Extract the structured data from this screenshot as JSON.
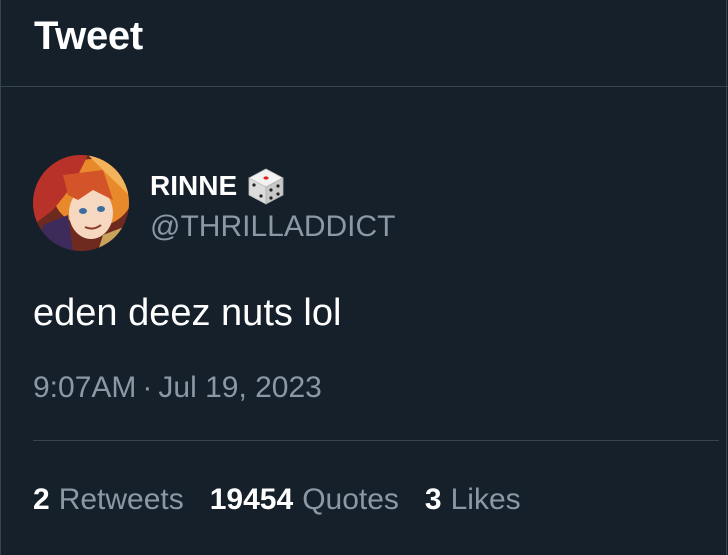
{
  "header": {
    "title": "Tweet"
  },
  "author": {
    "display_name": "RINNE",
    "badge_icon": "dice-icon",
    "handle": "@THRILLADDICT",
    "avatar_colors": [
      "#c0392b",
      "#e8892b",
      "#f3c270"
    ]
  },
  "tweet": {
    "text": "eden deez nuts lol",
    "time": "9:07AM",
    "separator": "·",
    "date": "Jul 19, 2023"
  },
  "stats": {
    "retweets_count": "2",
    "retweets_label": "Retweets",
    "quotes_count": "19454",
    "quotes_label": "Quotes",
    "likes_count": "3",
    "likes_label": "Likes"
  },
  "colors": {
    "background": "#15202b",
    "border": "#38444d",
    "primary_text": "#ffffff",
    "secondary_text": "#8b98a5"
  }
}
